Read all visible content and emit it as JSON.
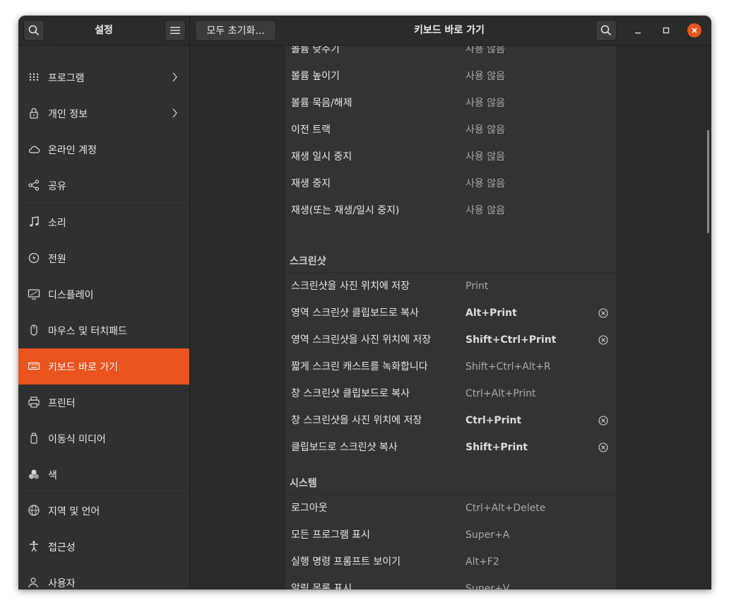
{
  "window": {
    "sidebar_title": "설정",
    "reset_button": "모두 초기화...",
    "content_title": "키보드 바로 가기"
  },
  "sidebar": {
    "items": [
      {
        "label": "배경",
        "icon": "background-icon"
      },
      {
        "label": "프로그램",
        "icon": "apps-grid-icon",
        "chevron": true
      },
      {
        "label": "개인 정보",
        "icon": "lock-icon",
        "chevron": true
      },
      {
        "label": "온라인 계정",
        "icon": "cloud-icon"
      },
      {
        "label": "공유",
        "icon": "share-icon"
      },
      {
        "label": "소리",
        "icon": "music-note-icon"
      },
      {
        "label": "전원",
        "icon": "power-icon"
      },
      {
        "label": "디스플레이",
        "icon": "display-icon"
      },
      {
        "label": "마우스 및 터치패드",
        "icon": "mouse-icon"
      },
      {
        "label": "키보드 바로 가기",
        "icon": "keyboard-icon",
        "active": true
      },
      {
        "label": "프린터",
        "icon": "printer-icon"
      },
      {
        "label": "이동식 미디어",
        "icon": "removable-media-icon"
      },
      {
        "label": "색",
        "icon": "color-icon"
      },
      {
        "label": "지역 및 언어",
        "icon": "globe-icon"
      },
      {
        "label": "접근성",
        "icon": "accessibility-icon"
      },
      {
        "label": "사용자",
        "icon": "users-icon"
      }
    ]
  },
  "shortcuts": {
    "sound_rows": [
      {
        "name": "볼륨 낮추기",
        "accel": "사용 않음"
      },
      {
        "name": "볼륨 높이기",
        "accel": "사용 않음"
      },
      {
        "name": "볼륨 묵음/해제",
        "accel": "사용 않음"
      },
      {
        "name": "이전 트랙",
        "accel": "사용 않음"
      },
      {
        "name": "재생 일시 중지",
        "accel": "사용 않음"
      },
      {
        "name": "재생 중지",
        "accel": "사용 않음"
      },
      {
        "name": "재생(또는 재생/일시 중지)",
        "accel": "사용 않음"
      }
    ],
    "screenshot_section": "스크린샷",
    "screenshot_rows": [
      {
        "name": "스크린샷을 사진 위치에 저장",
        "accel": "Print",
        "custom": false
      },
      {
        "name": "영역 스크린샷 클립보드로 복사",
        "accel": "Alt+Print",
        "custom": true
      },
      {
        "name": "영역 스크린샷을 사진 위치에 저장",
        "accel": "Shift+Ctrl+Print",
        "custom": true
      },
      {
        "name": "짧게 스크린 캐스트를 녹화합니다",
        "accel": "Shift+Ctrl+Alt+R",
        "custom": false
      },
      {
        "name": "창 스크린샷 클립보드로 복사",
        "accel": "Ctrl+Alt+Print",
        "custom": false
      },
      {
        "name": "창 스크린샷을 사진 위치에 저장",
        "accel": "Ctrl+Print",
        "custom": true
      },
      {
        "name": "클립보드로 스크린샷 복사",
        "accel": "Shift+Print",
        "custom": true
      }
    ],
    "system_section": "시스템",
    "system_rows": [
      {
        "name": "로그아웃",
        "accel": "Ctrl+Alt+Delete"
      },
      {
        "name": "모든 프로그램 표시",
        "accel": "Super+A"
      },
      {
        "name": "실행 명령 프롬프트 보이기",
        "accel": "Alt+F2"
      },
      {
        "name": "알림 목록 표시",
        "accel": "Super+V"
      }
    ]
  },
  "colors": {
    "accent": "#e95420",
    "close_button": "#e95420"
  }
}
